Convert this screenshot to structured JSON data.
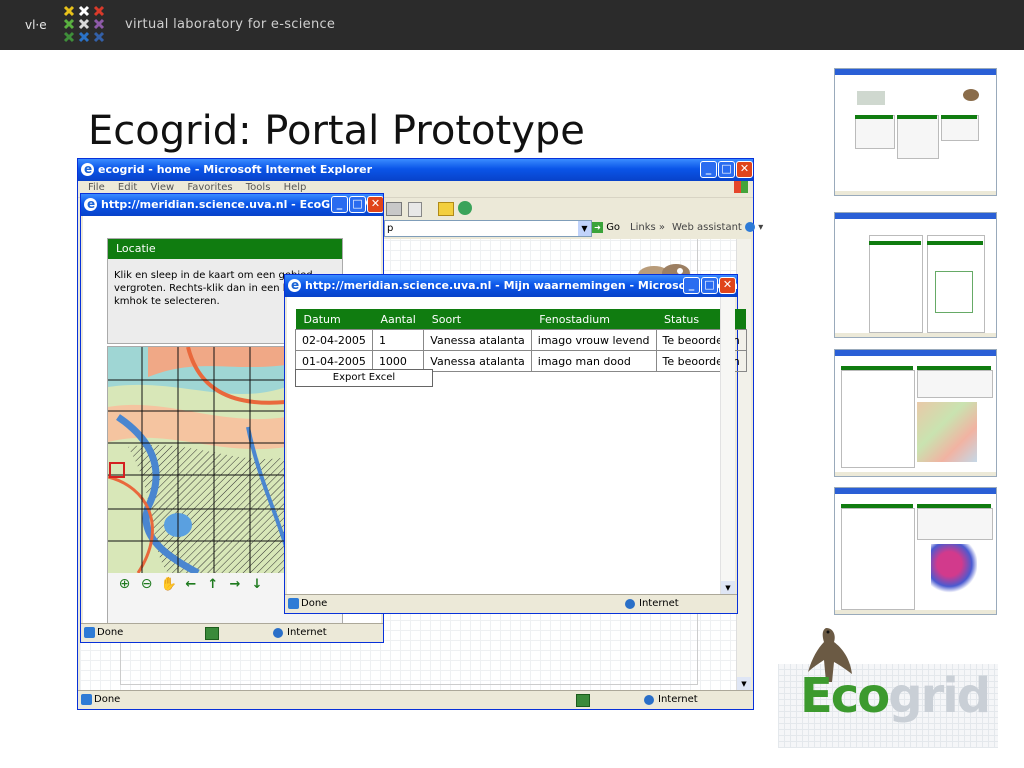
{
  "header": {
    "brand": "vl·e",
    "tagline": "virtual laboratory for e-science"
  },
  "slide": {
    "title": "Ecogrid: Portal Prototype"
  },
  "main_window": {
    "title": "ecogrid - home - Microsoft Internet Explorer",
    "menu": [
      "File",
      "Edit",
      "View",
      "Favorites",
      "Tools",
      "Help"
    ],
    "address_tail": "p",
    "go_label": "Go",
    "links_label": "Links",
    "links_chevron": "»",
    "web_assistant": "Web assistant",
    "status_text": "Done",
    "zone": "Internet"
  },
  "map_window": {
    "title": "http://meridian.science.uva.nl - EcoGrid - Micro...",
    "panel_title": "Locatie",
    "instruction": "Klik en sleep in de kaart om een gebied te vergroten. Rechts-klik dan in een km hok te selecteren.",
    "instruction_lines": [
      "Klik en sleep in de kaart om een gebied",
      "vergroten. Rechts-klik dan in een kmh",
      "kmhok te selecteren."
    ],
    "status_text": "Done",
    "zone": "Internet",
    "tools": [
      "zoom-in-icon",
      "zoom-out-icon",
      "pan-icon",
      "arrow-left-icon",
      "arrow-up-icon",
      "arrow-right-icon",
      "arrow-down-icon"
    ]
  },
  "obs_window": {
    "title": "http://meridian.science.uva.nl - Mijn waarnemingen - Microsoft Internet Explorer",
    "columns": [
      "Datum",
      "Aantal",
      "Soort",
      "Fenostadium",
      "Status"
    ],
    "rows": [
      [
        "02-04-2005",
        "1",
        "Vanessa atalanta",
        "imago vrouw levend",
        "Te beoordelen"
      ],
      [
        "01-04-2005",
        "1000",
        "Vanessa atalanta",
        "imago man dood",
        "Te beoordelen"
      ]
    ],
    "export_label": "Export Excel",
    "status_text": "Done",
    "zone": "Internet"
  },
  "logo": {
    "eco": "Eco",
    "grid": "grid"
  },
  "colors": {
    "header_bg": "#2b2b2b",
    "panel_green": "#107c10",
    "xp_blue": "#0a55e8"
  }
}
